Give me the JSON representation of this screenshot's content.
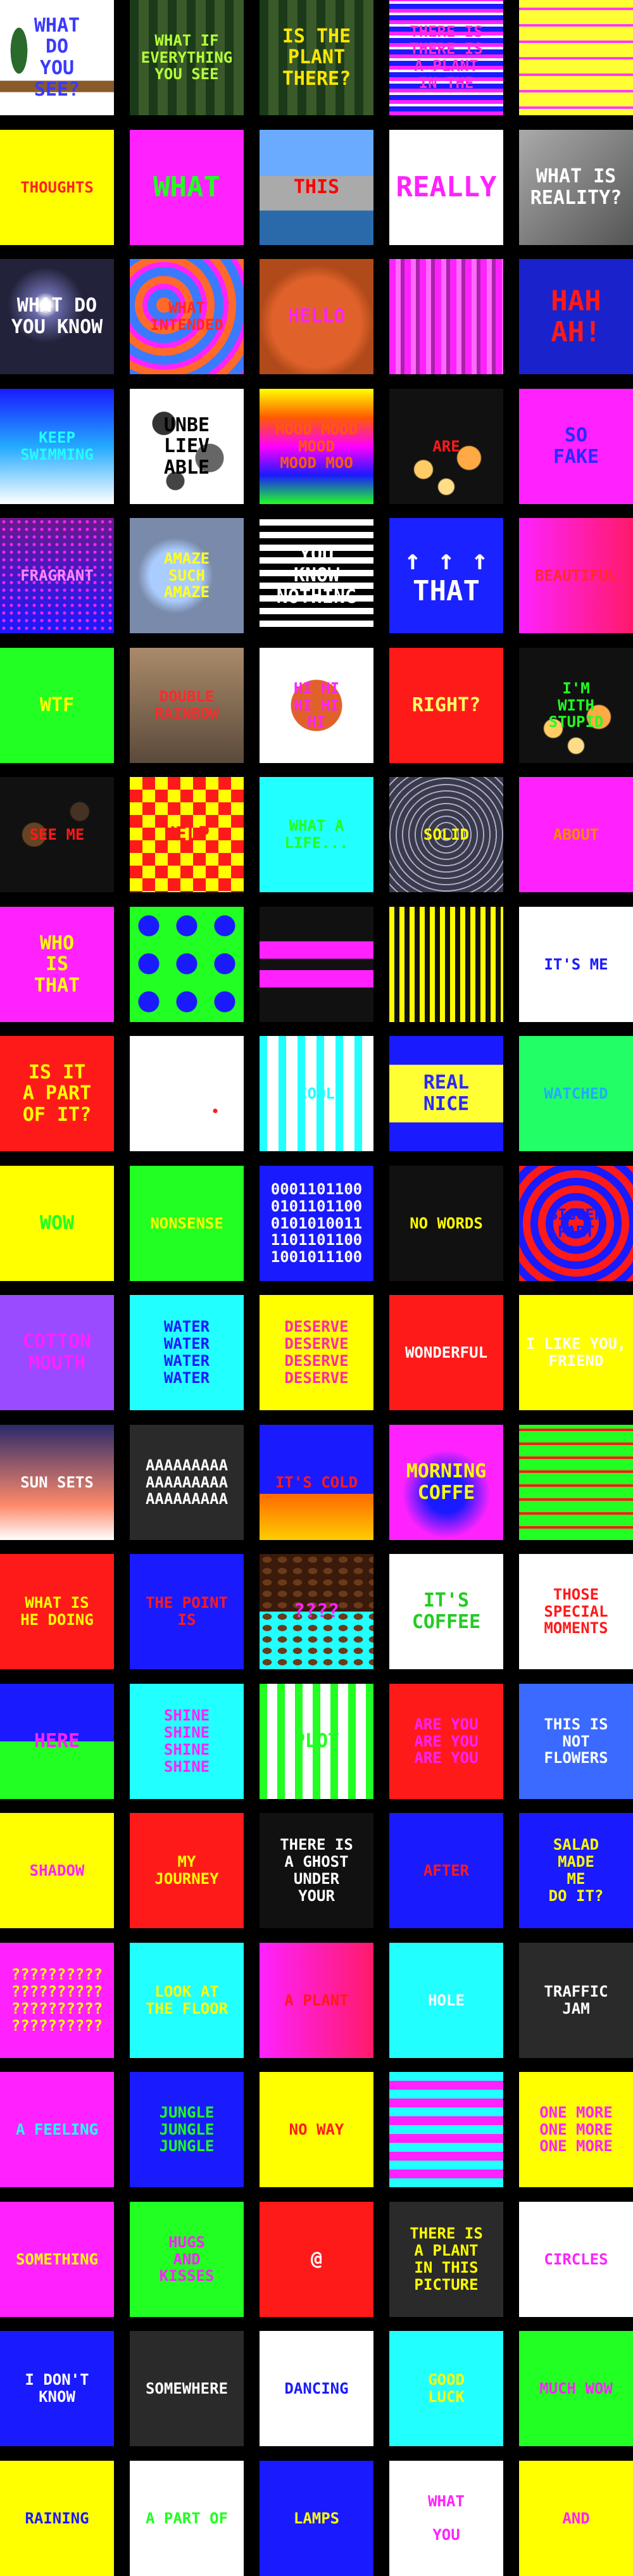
{
  "tiles": [
    {
      "text": "WHAT\nDO\nYOU\nSEE?",
      "bg": "#ffffff",
      "fg": "#3a3aff",
      "deco": "plant"
    },
    {
      "text": "WHAT IF\nEVERYTHING\nYOU SEE",
      "bg": "#2f5e2a",
      "fg": "#b6ff3a",
      "deco": "forest",
      "cls": "small"
    },
    {
      "text": "IS THE\nPLANT\nTHERE?",
      "bg": "#4a6b3a",
      "fg": "#ffe600",
      "deco": "forest"
    },
    {
      "text": "THERE IS\nTHERE IS\nA PLANT\nIN THE",
      "bg": "#1a1a2e",
      "fg": "#ff2bd6",
      "deco": "noise",
      "cls": "small"
    },
    {
      "text": "",
      "bg": "#ffff33",
      "fg": "#00ff88",
      "deco": "stripes-yellow"
    },
    {
      "text": "THOUGHTS",
      "bg": "#ffff00",
      "fg": "#ff2222",
      "deco": "none",
      "cls": "small"
    },
    {
      "text": "WHAT",
      "bg": "#ff22ff",
      "fg": "#22ff22",
      "deco": "none",
      "cls": "big"
    },
    {
      "text": "THIS",
      "bg": "#3a6aa8",
      "fg": "#ff0000",
      "deco": "city"
    },
    {
      "text": "REALLY",
      "bg": "#ffffff",
      "fg": "#ff22ff",
      "deco": "none",
      "cls": "big"
    },
    {
      "text": "WHAT IS\nREALITY?",
      "bg": "#888888",
      "fg": "#ffffff",
      "deco": "gray"
    },
    {
      "text": "WHAT DO\nYOU KNOW",
      "bg": "#22223a",
      "fg": "#ffffff",
      "deco": "night"
    },
    {
      "text": "WHAT\nINTENDED",
      "bg": "#3a7aff",
      "fg": "#ff2a2a",
      "deco": "swirl",
      "cls": "small"
    },
    {
      "text": "HELLO",
      "bg": "#d3522a",
      "fg": "#ff22ff",
      "deco": "ball"
    },
    {
      "text": "",
      "bg": "#ff22ff",
      "fg": "#ffffff",
      "deco": "bars-magenta"
    },
    {
      "text": "HAH\nAH!",
      "bg": "#1a22cc",
      "fg": "#ff1a1a",
      "deco": "none",
      "cls": "big"
    },
    {
      "text": "KEEP\nSWIMMING",
      "bg": "#0a0aff",
      "fg": "#22ffff",
      "deco": "water",
      "cls": "small"
    },
    {
      "text": "UNBE\nLIEV\nABLE",
      "bg": "#ffffff",
      "fg": "#000000",
      "deco": "dots"
    },
    {
      "text": "MOOD MOOD\nMOOD\nMOOD MOO",
      "bg": "#ffff00",
      "fg": "#ff5a00",
      "deco": "rainbow",
      "cls": "small"
    },
    {
      "text": "ARE",
      "bg": "#111111",
      "fg": "#ff1a1a",
      "deco": "bokeh",
      "cls": "small"
    },
    {
      "text": "SO\nFAKE",
      "bg": "#ff22ff",
      "fg": "#2a2aff",
      "deco": "none"
    },
    {
      "text": "FRAGRANT",
      "bg": "#6a1a8a",
      "fg": "#ff88ff",
      "deco": "glitter",
      "cls": "small"
    },
    {
      "text": "AMAZE\nSUCH\nAMAZE",
      "bg": "#7a8aaa",
      "fg": "#ffff22",
      "deco": "bubble",
      "cls": "small"
    },
    {
      "text": "YOU\nKNOW\nNOTHING",
      "bg": "#ffffff",
      "fg": "#ffffff",
      "deco": "hstripes"
    },
    {
      "text": "↑ ↑ ↑\nTHAT",
      "bg": "#1a22ff",
      "fg": "#ffffff",
      "deco": "none",
      "cls": "big"
    },
    {
      "text": "BEAUTIFUL",
      "bg": "#ff22aa",
      "fg": "#ff2a2a",
      "deco": "pinkgrad",
      "cls": "small"
    },
    {
      "text": "WTF",
      "bg": "#22ff22",
      "fg": "#ffff00",
      "deco": "none"
    },
    {
      "text": "DOUBLE\nRAINBOW",
      "bg": "#aa8a6a",
      "fg": "#ff2a2a",
      "deco": "photo",
      "cls": "small"
    },
    {
      "text": "HI HI\nHI HI\nHI",
      "bg": "#ffffff",
      "fg": "#ff22ff",
      "deco": "ballwhite",
      "cls": "small"
    },
    {
      "text": "RIGHT?",
      "bg": "#ff1a1a",
      "fg": "#ffff66",
      "deco": "none"
    },
    {
      "text": "I'M\nWITH\nSTUPID",
      "bg": "#111111",
      "fg": "#22ff22",
      "deco": "bokeh",
      "cls": "small"
    },
    {
      "text": "SEE ME",
      "bg": "#111111",
      "fg": "#ff1a1a",
      "deco": "bokehdark",
      "cls": "small"
    },
    {
      "text": "HELP",
      "bg": "#ffff00",
      "fg": "#ff1a1a",
      "deco": "checker"
    },
    {
      "text": "WHAT A\nLIFE...",
      "bg": "#22ffff",
      "fg": "#22ff22",
      "deco": "none",
      "cls": "small"
    },
    {
      "text": "SOLID",
      "bg": "#3a3a4a",
      "fg": "#ffff00",
      "deco": "water-dark",
      "cls": "small"
    },
    {
      "text": "ABOUT",
      "bg": "#ff22ff",
      "fg": "#ff8a00",
      "deco": "none",
      "cls": "small"
    },
    {
      "text": "WHO\nIS\nTHAT",
      "bg": "#ff22ff",
      "fg": "#ffff00",
      "deco": "none"
    },
    {
      "text": "",
      "bg": "#22ff22",
      "fg": "#ffffff",
      "deco": "bluedots"
    },
    {
      "text": "",
      "bg": "#111111",
      "fg": "#ff22ff",
      "deco": "magentabars"
    },
    {
      "text": "",
      "bg": "#111111",
      "fg": "#ffff00",
      "deco": "yellowbars"
    },
    {
      "text": "IT'S ME",
      "bg": "#ffffff",
      "fg": "#1a1aff",
      "deco": "none",
      "cls": "small"
    },
    {
      "text": "IS IT\nA PART\nOF IT?",
      "bg": "#ff1a1a",
      "fg": "#ffff00",
      "deco": "none"
    },
    {
      "text": "",
      "bg": "#ffffff",
      "fg": "#ff1a1a",
      "deco": "dot"
    },
    {
      "text": "COOL",
      "bg": "#ffffff",
      "fg": "#22ffff",
      "deco": "cyanbars",
      "cls": "small"
    },
    {
      "text": "REAL\nNICE",
      "bg": "#1a1aff",
      "fg": "#2a2aff",
      "deco": "nicebox"
    },
    {
      "text": "WATCHED",
      "bg": "#22ff66",
      "fg": "#22aaff",
      "deco": "none",
      "cls": "small"
    },
    {
      "text": "WOW",
      "bg": "#ffff00",
      "fg": "#22ff22",
      "deco": "none"
    },
    {
      "text": "NONSENSE",
      "bg": "#22ff22",
      "fg": "#ffff00",
      "deco": "none",
      "cls": "small"
    },
    {
      "text": "0001101100\n0101101100\n0101010011\n1101101100\n1001011100",
      "bg": "#1a1aff",
      "fg": "#ffffff",
      "deco": "none",
      "cls": "small"
    },
    {
      "text": "NO WORDS",
      "bg": "#111111",
      "fg": "#ffff00",
      "deco": "none",
      "cls": "small"
    },
    {
      "text": "BIGGER\nPART",
      "bg": "#ff22ff",
      "fg": "#1a1aff",
      "deco": "squares",
      "cls": "small"
    },
    {
      "text": "COTTON\nMOUTH",
      "bg": "#9a4aff",
      "fg": "#ff22ff",
      "deco": "none"
    },
    {
      "text": "WATER\nWATER\nWATER\nWATER",
      "bg": "#22ffff",
      "fg": "#1a1aff",
      "deco": "none",
      "cls": "small"
    },
    {
      "text": "DESERVE\nDESERVE\nDESERVE\nDESERVE",
      "bg": "#ffff00",
      "fg": "#ff2aaa",
      "deco": "none",
      "cls": "small"
    },
    {
      "text": "WONDERFUL",
      "bg": "#ff1a1a",
      "fg": "#ffffff",
      "deco": "none",
      "cls": "small"
    },
    {
      "text": "I LIKE YOU,\nFRIEND",
      "bg": "#ffff00",
      "fg": "#ffffff",
      "deco": "none",
      "cls": "small"
    },
    {
      "text": "SUN SETS",
      "bg": "#2a2a6a",
      "fg": "#ffffff",
      "deco": "sunset",
      "cls": "small"
    },
    {
      "text": "AAAAAAAAA\nAAAAAAAAA\nAAAAAAAAA",
      "bg": "#2a2a2a",
      "fg": "#ffffff",
      "deco": "none",
      "cls": "small"
    },
    {
      "text": "IT'S COLD",
      "bg": "#1a1aff",
      "fg": "#ff1a1a",
      "deco": "fire",
      "cls": "small"
    },
    {
      "text": "MORNING\nCOFFE",
      "bg": "#ff22ff",
      "fg": "#ffff00",
      "deco": "glow"
    },
    {
      "text": "",
      "bg": "#22ff22",
      "fg": "#ff1a1a",
      "deco": "greenrings"
    },
    {
      "text": "WHAT IS\nHE DOING",
      "bg": "#ff1a1a",
      "fg": "#ffff00",
      "deco": "none",
      "cls": "small"
    },
    {
      "text": "THE POINT IS",
      "bg": "#1a1aff",
      "fg": "#ff1a1a",
      "deco": "none",
      "cls": "small"
    },
    {
      "text": "????",
      "bg": "#22ffff",
      "fg": "#ff22ff",
      "deco": "beans"
    },
    {
      "text": "IT'S\nCOFFEE",
      "bg": "#ffffff",
      "fg": "#22cc22",
      "deco": "none"
    },
    {
      "text": "THOSE\nSPECIAL\nMOMENTS",
      "bg": "#ffffff",
      "fg": "#ff1a1a",
      "deco": "none",
      "cls": "small"
    },
    {
      "text": "HERE",
      "bg": "#22ff22",
      "fg": "#ff22ff",
      "deco": "halfblue"
    },
    {
      "text": "SHINE\nSHINE\nSHINE\nSHINE",
      "bg": "#22ffff",
      "fg": "#ff22ff",
      "deco": "none",
      "cls": "small"
    },
    {
      "text": "PLOT",
      "bg": "#ffffff",
      "fg": "#22ff22",
      "deco": "greenbars"
    },
    {
      "text": "ARE YOU\nARE YOU\nARE YOU",
      "bg": "#ff1a1a",
      "fg": "#ff22ff",
      "deco": "none",
      "cls": "small"
    },
    {
      "text": "THIS IS\nNOT\nFLOWERS",
      "bg": "#3a6aff",
      "fg": "#ffffff",
      "deco": "none",
      "cls": "small"
    },
    {
      "text": "SHADOW",
      "bg": "#ffff00",
      "fg": "#ff22ff",
      "deco": "none",
      "cls": "small"
    },
    {
      "text": "MY\nJOURNEY",
      "bg": "#ff1a1a",
      "fg": "#ffff00",
      "deco": "none",
      "cls": "small"
    },
    {
      "text": "THERE IS\nA GHOST\nUNDER\nYOUR",
      "bg": "#111111",
      "fg": "#ffffff",
      "deco": "none",
      "cls": "small"
    },
    {
      "text": "AFTER",
      "bg": "#1a1aff",
      "fg": "#ff1a1a",
      "deco": "none",
      "cls": "small"
    },
    {
      "text": "SALAD\nMADE\nME\nDO IT?",
      "bg": "#1a1aff",
      "fg": "#ffff00",
      "deco": "none",
      "cls": "small"
    },
    {
      "text": "??????????\n??????????\n??????????\n??????????",
      "bg": "#ff22ff",
      "fg": "#ffff00",
      "deco": "none",
      "cls": "small"
    },
    {
      "text": "LOOK AT\nTHE FLOOR",
      "bg": "#22ffff",
      "fg": "#ffff00",
      "deco": "none",
      "cls": "small"
    },
    {
      "text": "A PLANT",
      "bg": "#ff22ff",
      "fg": "#ff1a1a",
      "deco": "pinkgrad",
      "cls": "small"
    },
    {
      "text": "HOLE",
      "bg": "#22ffff",
      "fg": "#ffffff",
      "deco": "none",
      "cls": "small"
    },
    {
      "text": "TRAFFIC\nJAM",
      "bg": "#2a2a2a",
      "fg": "#ffffff",
      "deco": "none",
      "cls": "small"
    },
    {
      "text": "A FEELING",
      "bg": "#ff22ff",
      "fg": "#22ffff",
      "deco": "none",
      "cls": "small"
    },
    {
      "text": "JUNGLE\nJUNGLE\nJUNGLE",
      "bg": "#1a1aff",
      "fg": "#22ff22",
      "deco": "none",
      "cls": "small"
    },
    {
      "text": "NO WAY",
      "bg": "#ffff00",
      "fg": "#ff1a1a",
      "deco": "none",
      "cls": "small"
    },
    {
      "text": "",
      "bg": "#22ffff",
      "fg": "#ff22ff",
      "deco": "waves"
    },
    {
      "text": "ONE MORE\nONE MORE\nONE MORE",
      "bg": "#ffff00",
      "fg": "#ff22ff",
      "deco": "none",
      "cls": "small"
    },
    {
      "text": "SOMETHING",
      "bg": "#ff22ff",
      "fg": "#ffff00",
      "deco": "none",
      "cls": "small"
    },
    {
      "text": "HUGS\nAND\nKISSES",
      "bg": "#22ff22",
      "fg": "#ff22ff",
      "deco": "none",
      "cls": "small"
    },
    {
      "text": "@",
      "bg": "#ff1a1a",
      "fg": "#ffffff",
      "deco": "none"
    },
    {
      "text": "THERE IS\nA PLANT\nIN THIS\nPICTURE",
      "bg": "#2a2a2a",
      "fg": "#ffff00",
      "deco": "none",
      "cls": "small"
    },
    {
      "text": "CIRCLES",
      "bg": "#ffffff",
      "fg": "#ff22ff",
      "deco": "none",
      "cls": "small"
    },
    {
      "text": "I DON'T\nKNOW",
      "bg": "#1a1aff",
      "fg": "#ffffff",
      "deco": "none",
      "cls": "small"
    },
    {
      "text": "SOMEWHERE",
      "bg": "#2a2a2a",
      "fg": "#ffffff",
      "deco": "none",
      "cls": "small"
    },
    {
      "text": "DANCING",
      "bg": "#ffffff",
      "fg": "#1a1aff",
      "deco": "none",
      "cls": "small"
    },
    {
      "text": "GOOD\nLUCK",
      "bg": "#22ffff",
      "fg": "#ffff00",
      "deco": "none",
      "cls": "small"
    },
    {
      "text": "MUCH WOW",
      "bg": "#22ff22",
      "fg": "#ff22ff",
      "deco": "none",
      "cls": "small"
    },
    {
      "text": "RAINING",
      "bg": "#ffff00",
      "fg": "#1a1aff",
      "deco": "none",
      "cls": "small"
    },
    {
      "text": "A PART OF",
      "bg": "#ffffff",
      "fg": "#22ff22",
      "deco": "none",
      "cls": "small"
    },
    {
      "text": "LAMPS",
      "bg": "#1a1aff",
      "fg": "#ffff00",
      "deco": "none",
      "cls": "small"
    },
    {
      "text": "WHAT\n\nYOU",
      "bg": "#ffffff",
      "fg": "#ff22ff",
      "deco": "none",
      "cls": "small"
    },
    {
      "text": "AND",
      "bg": "#ffff00",
      "fg": "#ff22ff",
      "deco": "none",
      "cls": "small"
    }
  ]
}
